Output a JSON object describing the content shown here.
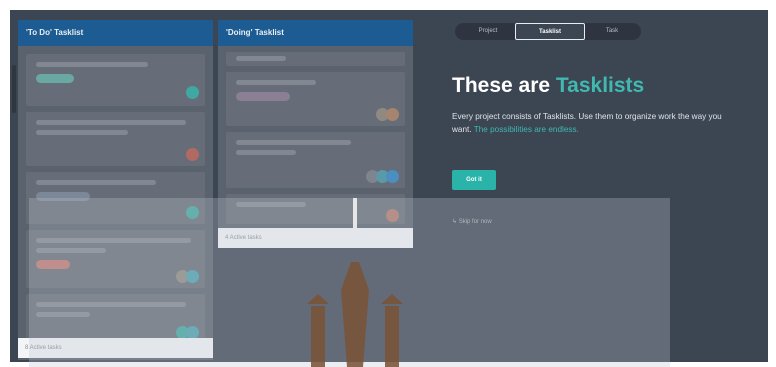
{
  "todo_list": {
    "header": "'To Do' Tasklist",
    "footer": "8 Active tasks"
  },
  "doing_list": {
    "header": "'Doing' Tasklist",
    "footer": "4 Active tasks"
  },
  "stepper": {
    "steps": [
      "Project",
      "Tasklist",
      "Task"
    ],
    "active_step": "Tasklist"
  },
  "tour": {
    "title_prefix": "These are ",
    "title_highlight": "Tasklists",
    "description": "Every project consists of Tasklists. Use them to organize work the way you want. ",
    "description_highlight": "The possibilities are endless.",
    "button_label": "Got it",
    "skip_label": "Skip for now"
  },
  "colors": {
    "app_background": "#3c4552",
    "column_header": "#1c5c92",
    "accent_teal": "#2ab3a8",
    "card": "#666d78"
  },
  "icons": {
    "watermark": "watermark-logo",
    "skip": "skip-arrow-icon"
  }
}
